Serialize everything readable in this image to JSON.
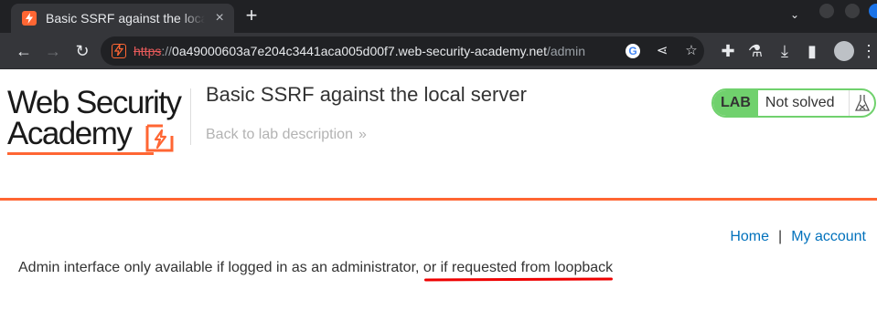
{
  "browser": {
    "tab": {
      "title": "Basic SSRF against the local server",
      "close_icon": "×"
    },
    "new_tab_icon": "+",
    "tab_search_icon": "⌄",
    "url": {
      "scheme": "https",
      "separator": "://",
      "host": "0a49000603a7e204c3441aca005d00f7.web-security-academy.net",
      "path": "/admin"
    },
    "nav_icons": {
      "back": "←",
      "forward": "→",
      "reload": "↻"
    },
    "omnibox_icons": {
      "google": "G",
      "share": "⋖",
      "bookmark": "☆"
    },
    "toolbar_icons": {
      "extensions": "✚",
      "labs": "⚗",
      "download": "⤓",
      "sidepanel": "▮",
      "menu": "⋮"
    }
  },
  "header": {
    "logo": {
      "line1": "Web Security",
      "line2": "Academy"
    },
    "lab_title": "Basic SSRF against the local server",
    "back_link": "Back to lab description",
    "back_chevrons": "»",
    "lab_status": {
      "badge": "LAB",
      "state": "Not solved",
      "icon": "flask-icon"
    }
  },
  "nav": {
    "home": "Home",
    "separator": "|",
    "my_account": "My account"
  },
  "main": {
    "message_part1": "Admin interface only available if logged in as an administrator, ",
    "message_part2": "or if requested from loopback"
  },
  "colors": {
    "accent": "#ff6633",
    "lab_green": "#70d16d",
    "link": "#0071bc",
    "annotation": "#ee0000"
  }
}
